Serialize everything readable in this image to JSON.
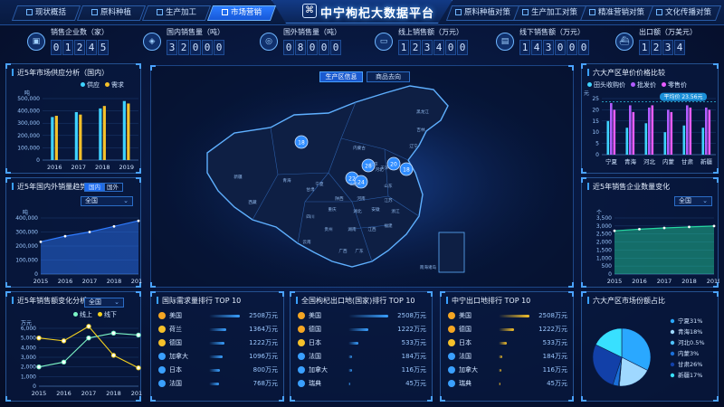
{
  "header": {
    "title": "中宁枸杞大数据平台",
    "left_tabs": [
      "现状概括",
      "原料种植",
      "生产加工",
      "市场营销"
    ],
    "right_tabs": [
      "原料种植对策",
      "生产加工对策",
      "精准营销对策",
      "文化传播对策"
    ],
    "active_tab": "市场营销"
  },
  "stats": [
    {
      "label": "销售企业数（家）",
      "digits": [
        "0",
        "1",
        "2",
        "4",
        "5"
      ]
    },
    {
      "label": "国内销售量（吨）",
      "digits": [
        "3",
        "2",
        "0",
        "0",
        "0"
      ]
    },
    {
      "label": "国外销售量（吨）",
      "digits": [
        "0",
        "8",
        "0",
        "0",
        "0"
      ]
    },
    {
      "label": "线上销售额（万元）",
      "digits": [
        "1",
        "2",
        "3",
        "4",
        "0",
        "0"
      ]
    },
    {
      "label": "线下销售额（万元）",
      "digits": [
        "1",
        "4",
        "3",
        "0",
        "0",
        "0"
      ]
    },
    {
      "label": "出口额（万美元）",
      "digits": [
        "1",
        "2",
        "3",
        "4"
      ]
    }
  ],
  "map": {
    "tabs": [
      "生产区信息",
      "商品去向"
    ],
    "markers": [
      "18",
      "28",
      "20",
      "22",
      "24",
      "18"
    ],
    "place_labels": [
      "新疆",
      "西藏",
      "青海",
      "甘肃",
      "内蒙古",
      "四川",
      "云南",
      "广西",
      "广东",
      "湖南",
      "江西",
      "福建",
      "浙江",
      "江苏",
      "山东",
      "河北",
      "北京",
      "天津",
      "辽宁",
      "吉林",
      "黑龙江",
      "陕西",
      "山西",
      "河南",
      "湖北",
      "安徽",
      "重庆",
      "贵州",
      "宁夏",
      "南海诸岛"
    ]
  },
  "p1": {
    "title": "近5年市场供应分析（国内）",
    "unit": "吨",
    "legend": [
      "供应",
      "需求"
    ],
    "colors": [
      "#3fd3ff",
      "#f5c12a"
    ],
    "chart_data": {
      "type": "bar",
      "categories": [
        "2016",
        "2017",
        "2018",
        "2019"
      ],
      "series": [
        {
          "name": "供应",
          "values": [
            350000,
            390000,
            420000,
            480000
          ]
        },
        {
          "name": "需求",
          "values": [
            360000,
            370000,
            440000,
            460000
          ]
        }
      ],
      "ylim": [
        0,
        500000
      ],
      "yticks": [
        "0",
        "100,000",
        "200,000",
        "300,000",
        "400,000",
        "500,000"
      ]
    }
  },
  "p2": {
    "title": "近5年国内外销量趋势",
    "toggle": [
      "国内",
      "国外"
    ],
    "select": "全国",
    "unit": "吨",
    "chart_data": {
      "type": "area",
      "categories": [
        "2015",
        "2016",
        "2017",
        "2018",
        "2019"
      ],
      "values": [
        230000,
        270000,
        300000,
        340000,
        380000
      ],
      "ylim": [
        0,
        400000
      ],
      "yticks": [
        "0",
        "100,000",
        "200,000",
        "300,000",
        "400,000"
      ]
    }
  },
  "p3": {
    "title": "近5年销售额变化分析",
    "select": "全国",
    "unit": "万元",
    "legend": [
      "线上",
      "线下"
    ],
    "colors": [
      "#7cf5c6",
      "#f5d21f"
    ],
    "chart_data": {
      "type": "line",
      "categories": [
        "2015",
        "2016",
        "2017",
        "2018",
        "2019"
      ],
      "series": [
        {
          "name": "线上",
          "values": [
            2000,
            2500,
            5000,
            5500,
            5300
          ]
        },
        {
          "name": "线下",
          "values": [
            5000,
            4700,
            6200,
            3200,
            1900
          ]
        }
      ],
      "ylim": [
        0,
        6000
      ],
      "yticks": [
        "0",
        "1,000",
        "2,000",
        "3,000",
        "4,000",
        "5,000",
        "6,000"
      ]
    }
  },
  "r1": {
    "title": "六大产区单价价格比较",
    "unit": "元",
    "legend": [
      "田头收购价",
      "批发价",
      "零售价"
    ],
    "colors": [
      "#3fd3ff",
      "#b25cff",
      "#e85cff"
    ],
    "tooltip": "平均价 23.56元",
    "chart_data": {
      "type": "bar",
      "categories": [
        "宁夏",
        "青海",
        "河北",
        "内蒙",
        "甘肃",
        "新疆"
      ],
      "series": [
        {
          "name": "田头收购价",
          "values": [
            15,
            12,
            14,
            10,
            13,
            12
          ]
        },
        {
          "name": "批发价",
          "values": [
            23,
            22,
            21,
            20,
            22,
            21
          ]
        },
        {
          "name": "零售价",
          "values": [
            20,
            19,
            22,
            19,
            21,
            20
          ]
        }
      ],
      "ylim": [
        0,
        25
      ],
      "yticks": [
        "0",
        "5",
        "10",
        "15",
        "20",
        "25"
      ]
    }
  },
  "r2": {
    "title": "近5年销售企业数量变化",
    "select": "全国",
    "unit": "个",
    "chart_data": {
      "type": "area",
      "categories": [
        "2015",
        "2016",
        "2017",
        "2018",
        "2019"
      ],
      "values": [
        2700,
        2800,
        2880,
        2940,
        3000
      ],
      "ylim": [
        0,
        3500
      ],
      "yticks": [
        "0",
        "500",
        "1,000",
        "1,500",
        "2,000",
        "2,500",
        "3,000",
        "3,500"
      ]
    }
  },
  "r3": {
    "title": "六大产区市场份额占比",
    "chart_data": {
      "type": "pie",
      "labels": [
        "宁夏",
        "青海",
        "河北",
        "内蒙",
        "甘肃",
        "新疆"
      ],
      "values": [
        31,
        18,
        0.5,
        3,
        26,
        17
      ],
      "value_labels": [
        "31%",
        "18%",
        "0.5%",
        "3%",
        "26%",
        "17%"
      ],
      "colors": [
        "#2aa8ff",
        "#9fd8ff",
        "#4fc3ff",
        "#1a6fd8",
        "#1240a8",
        "#38e0ff"
      ]
    }
  },
  "rank1": {
    "title": "国际需求量排行 TOP 10",
    "items": [
      {
        "name": "美国",
        "value": "2508万元"
      },
      {
        "name": "荷兰",
        "value": "1364万元"
      },
      {
        "name": "德国",
        "value": "1222万元"
      },
      {
        "name": "加拿大",
        "value": "1096万元"
      },
      {
        "name": "日本",
        "value": "800万元"
      },
      {
        "name": "法国",
        "value": "768万元"
      }
    ],
    "icon_colors": [
      "#f5a623",
      "#f5c12a",
      "#f5c12a",
      "#3aa0ff",
      "#3aa0ff",
      "#3aa0ff"
    ],
    "bar_fracs": [
      1.0,
      0.55,
      0.5,
      0.45,
      0.35,
      0.32
    ],
    "bar_color": "#3aa0ff"
  },
  "rank2": {
    "title": "全国枸杞出口地(国家)排行 TOP 10",
    "items": [
      {
        "name": "美国",
        "value": "2508万元"
      },
      {
        "name": "德国",
        "value": "1222万元"
      },
      {
        "name": "日本",
        "value": "533万元"
      },
      {
        "name": "法国",
        "value": "184万元"
      },
      {
        "name": "加拿大",
        "value": "116万元"
      },
      {
        "name": "瑞典",
        "value": "45万元"
      }
    ],
    "icon_colors": [
      "#f5a623",
      "#f5a623",
      "#f5c12a",
      "#3aa0ff",
      "#3aa0ff",
      "#3aa0ff"
    ],
    "bar_fracs": [
      1.0,
      0.5,
      0.25,
      0.1,
      0.08,
      0.04
    ],
    "bar_color": "#3aa0ff"
  },
  "rank3": {
    "title": "中宁出口地排行 TOP 10",
    "items": [
      {
        "name": "美国",
        "value": "2508万元"
      },
      {
        "name": "德国",
        "value": "1222万元"
      },
      {
        "name": "日本",
        "value": "533万元"
      },
      {
        "name": "法国",
        "value": "184万元"
      },
      {
        "name": "加拿大",
        "value": "116万元"
      },
      {
        "name": "瑞典",
        "value": "45万元"
      }
    ],
    "icon_colors": [
      "#f5a623",
      "#f5a623",
      "#f5c12a",
      "#3aa0ff",
      "#3aa0ff",
      "#3aa0ff"
    ],
    "bar_fracs": [
      1.0,
      0.5,
      0.25,
      0.12,
      0.08,
      0.05
    ],
    "bar_color": "#f5c12a"
  }
}
